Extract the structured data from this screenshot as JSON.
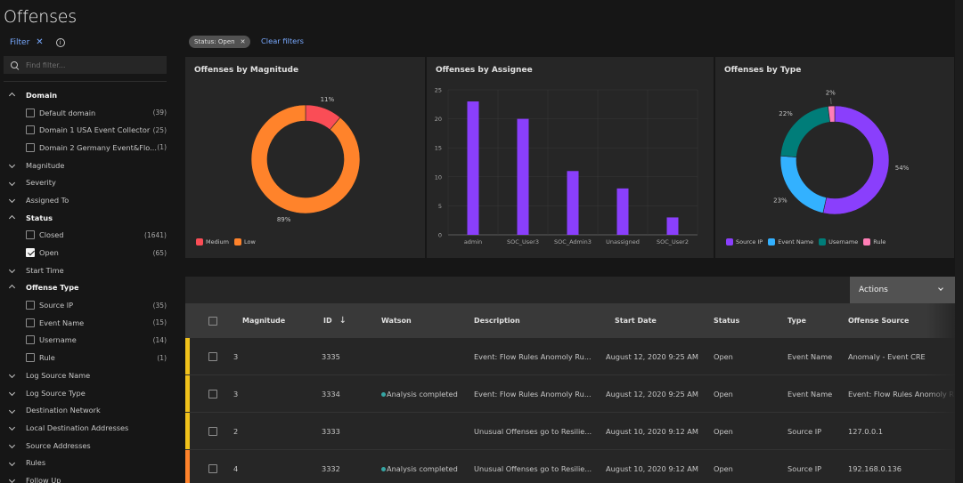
{
  "page": {
    "title": "Offenses"
  },
  "sidebar": {
    "filter_label": "Filter",
    "search_placeholder": "Find filter...",
    "facets": [
      {
        "label": "Domain",
        "expanded": true,
        "options": [
          {
            "label": "Default domain",
            "count": "(39)",
            "checked": false
          },
          {
            "label": "Domain 1 USA Event Collector",
            "count": "(25)",
            "checked": false
          },
          {
            "label": "Domain 2 Germany Event&Flo...",
            "count": "(1)",
            "checked": false
          }
        ]
      },
      {
        "label": "Magnitude",
        "expanded": false
      },
      {
        "label": "Severity",
        "expanded": false
      },
      {
        "label": "Assigned To",
        "expanded": false
      },
      {
        "label": "Status",
        "expanded": true,
        "options": [
          {
            "label": "Closed",
            "count": "(1641)",
            "checked": false
          },
          {
            "label": "Open",
            "count": "(65)",
            "checked": true
          }
        ]
      },
      {
        "label": "Start Time",
        "expanded": false
      },
      {
        "label": "Offense Type",
        "expanded": true,
        "options": [
          {
            "label": "Source IP",
            "count": "(35)",
            "checked": false
          },
          {
            "label": "Event Name",
            "count": "(15)",
            "checked": false
          },
          {
            "label": "Username",
            "count": "(14)",
            "checked": false
          },
          {
            "label": "Rule",
            "count": "(1)",
            "checked": false
          }
        ]
      },
      {
        "label": "Log Source Name",
        "expanded": false
      },
      {
        "label": "Log Source Type",
        "expanded": false
      },
      {
        "label": "Destination Network",
        "expanded": false
      },
      {
        "label": "Local Destination Addresses",
        "expanded": false
      },
      {
        "label": "Source Addresses",
        "expanded": false
      },
      {
        "label": "Rules",
        "expanded": false
      },
      {
        "label": "Follow Up",
        "expanded": false
      }
    ]
  },
  "filters": {
    "chip": "Status: Open",
    "clear_label": "Clear filters"
  },
  "chart_data": [
    {
      "type": "pie",
      "title": "Offenses by Magnitude",
      "categories": [
        "Medium",
        "Low"
      ],
      "values": [
        11,
        89
      ],
      "labels": [
        "11%",
        "89%"
      ],
      "colors": [
        "#fa4d56",
        "#ff832b"
      ],
      "donut": true,
      "legend": "bottom-left"
    },
    {
      "type": "bar",
      "title": "Offenses by Assignee",
      "categories": [
        "admin",
        "SOC_User3",
        "SOC_Admin3",
        "Unassigned",
        "SOC_User2"
      ],
      "values": [
        23,
        20,
        11,
        8,
        3
      ],
      "ylim": [
        0,
        25
      ],
      "yticks": [
        0,
        5,
        10,
        15,
        20,
        25
      ],
      "color": "#8a3ffc",
      "grid": true,
      "xlabel": "",
      "ylabel": ""
    },
    {
      "type": "pie",
      "title": "Offenses by Type",
      "categories": [
        "Source IP",
        "Event Name",
        "Username",
        "Rule"
      ],
      "values": [
        54,
        23,
        22,
        2
      ],
      "labels": [
        "54%",
        "23%",
        "22%",
        "2%"
      ],
      "colors": [
        "#8a3ffc",
        "#33b1ff",
        "#007d79",
        "#ff7eb6"
      ],
      "donut": true,
      "legend": "bottom-left"
    }
  ],
  "table": {
    "actions_label": "Actions",
    "columns": [
      "Magnitude",
      "ID",
      "Watson",
      "Description",
      "Start Date",
      "Status",
      "Type",
      "Offense Source"
    ],
    "sort_column": "ID",
    "rows": [
      {
        "severity_color": "#f1c21b",
        "magnitude": "3",
        "id": "3335",
        "watson": "",
        "description": "Event: Flow Rules Anomoly Ru...",
        "start_date": "August 12, 2020 9:25 AM",
        "status": "Open",
        "type": "Event Name",
        "source": "Anomaly - Event CRE"
      },
      {
        "severity_color": "#f1c21b",
        "magnitude": "3",
        "id": "3334",
        "watson": "Analysis completed",
        "description": "Event: Flow Rules Anomoly Ru...",
        "start_date": "August 12, 2020 9:25 AM",
        "status": "Open",
        "type": "Event Name",
        "source": "Event: Flow Rules Anomoly R"
      },
      {
        "severity_color": "#f1c21b",
        "magnitude": "2",
        "id": "3333",
        "watson": "",
        "description": "Unusual Offenses go to Resilie...",
        "start_date": "August 10, 2020 9:12 AM",
        "status": "Open",
        "type": "Source IP",
        "source": "127.0.0.1"
      },
      {
        "severity_color": "#ff832b",
        "magnitude": "4",
        "id": "3332",
        "watson": "Analysis completed",
        "description": "Unusual Offenses go to Resilie...",
        "start_date": "August 10, 2020 9:12 AM",
        "status": "Open",
        "type": "Source IP",
        "source": "192.168.0.136"
      }
    ]
  }
}
